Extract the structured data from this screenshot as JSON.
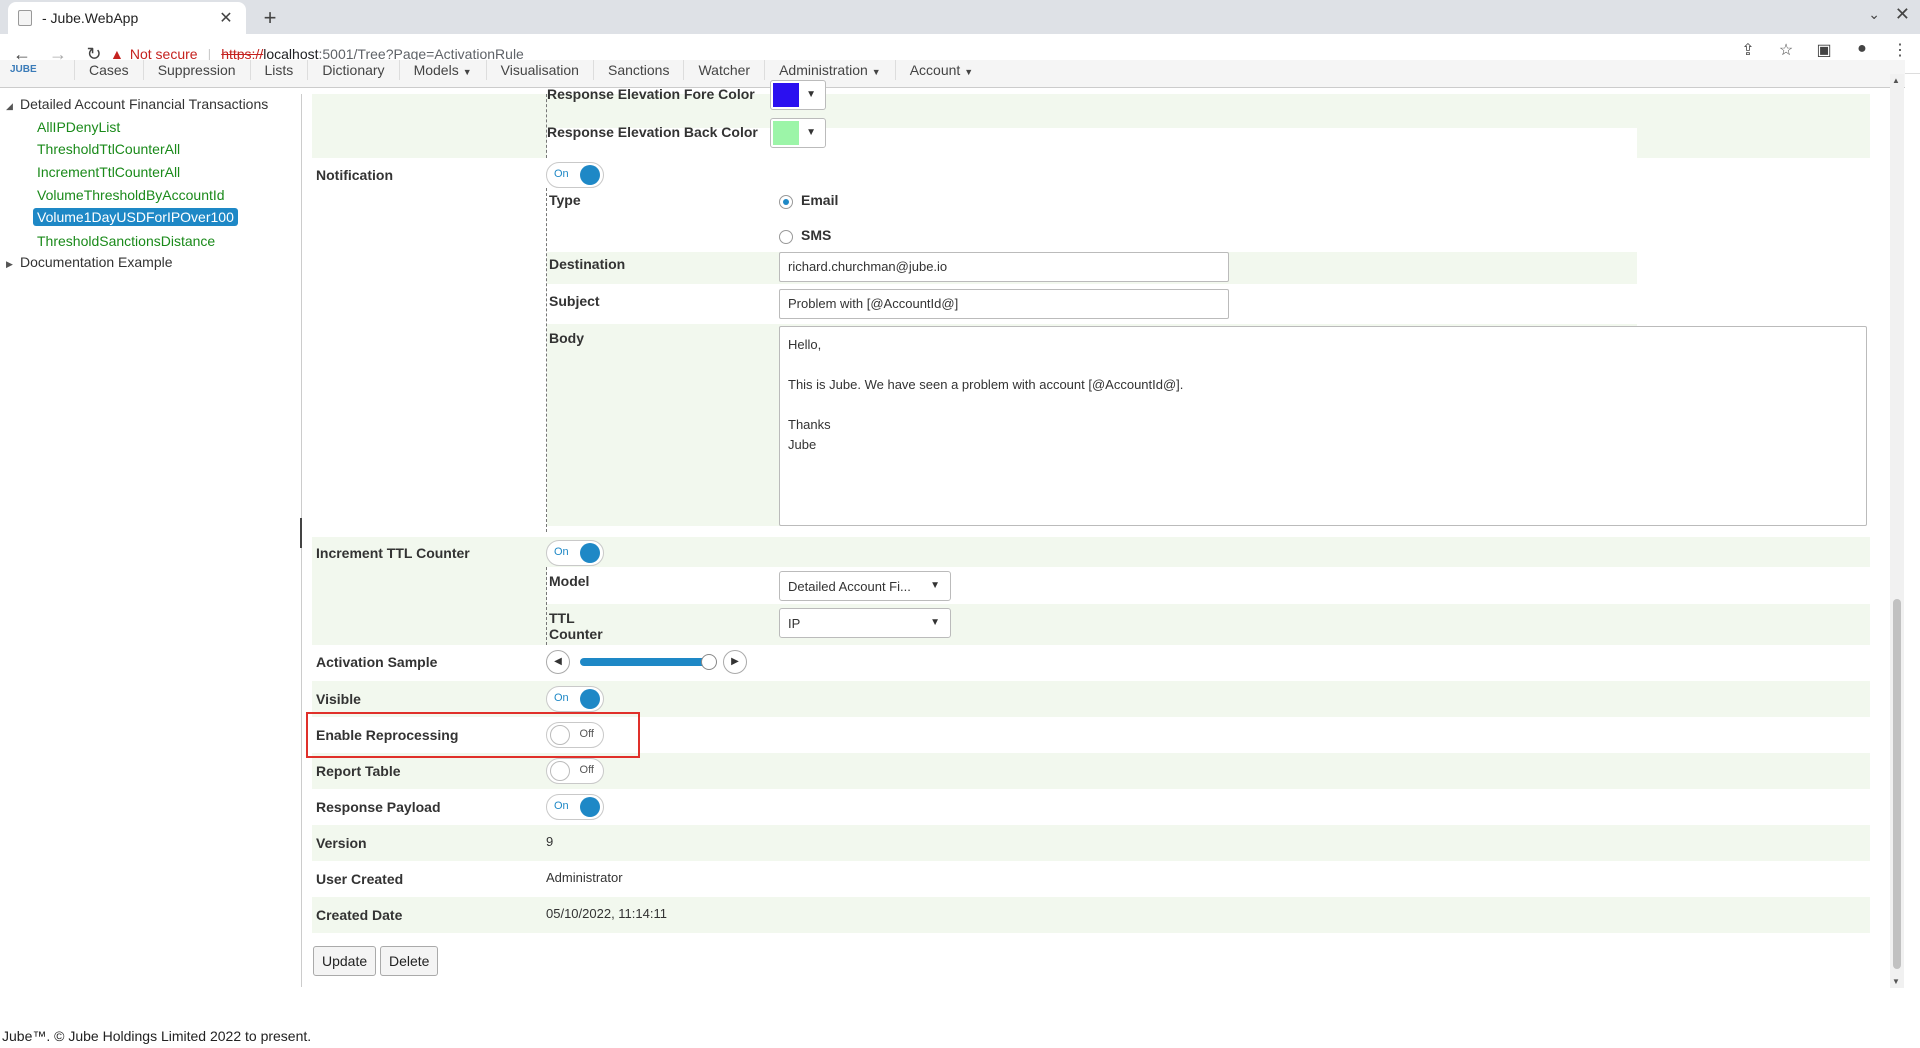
{
  "browser": {
    "tab_title": "- Jube.WebApp",
    "not_secure": "Not secure",
    "url_scheme": "https://",
    "url_host": "localhost",
    "url_path": ":5001/Tree?Page=ActivationRule"
  },
  "appnav": {
    "logo": "JUBE",
    "items": [
      "Cases",
      "Suppression",
      "Lists",
      "Dictionary",
      "Models",
      "Visualisation",
      "Sanctions",
      "Watcher",
      "Administration",
      "Account"
    ]
  },
  "tree": {
    "parent": "Detailed Account Financial Transactions",
    "children": [
      "AllIPDenyList",
      "ThresholdTtlCounterAll",
      "IncrementTtlCounterAll",
      "VolumeThresholdByAccountId",
      "Volume1DayUSDForIPOver100",
      "ThresholdSanctionsDistance"
    ],
    "selected_index": 4,
    "sibling": "Documentation Example"
  },
  "form": {
    "response_elevation_fore_color": {
      "label": "Response Elevation Fore Color",
      "color": "#2b10f0"
    },
    "response_elevation_back_color": {
      "label": "Response Elevation Back Color",
      "color": "#9cf5a8"
    },
    "notification": {
      "label": "Notification",
      "toggle": "On",
      "type_label": "Type",
      "type_options": [
        "Email",
        "SMS"
      ],
      "type_selected": "Email",
      "destination_label": "Destination",
      "destination_value": "richard.churchman@jube.io",
      "subject_label": "Subject",
      "subject_value": "Problem with [@AccountId@]",
      "body_label": "Body",
      "body_value": "Hello,\n\nThis is Jube.  We have seen a problem with account [@AccountId@].\n\nThanks\nJube"
    },
    "increment_ttl_counter": {
      "label": "Increment TTL Counter",
      "toggle": "On",
      "model_label": "Model",
      "model_value": "Detailed Account Fi...",
      "ttl_counter_label": "TTL Counter",
      "ttl_counter_value": "IP"
    },
    "activation_sample": {
      "label": "Activation Sample",
      "fraction": 0.95
    },
    "visible": {
      "label": "Visible",
      "toggle": "On"
    },
    "enable_reprocessing": {
      "label": "Enable Reprocessing",
      "toggle": "Off"
    },
    "report_table": {
      "label": "Report Table",
      "toggle": "Off"
    },
    "response_payload": {
      "label": "Response Payload",
      "toggle": "On"
    },
    "version": {
      "label": "Version",
      "value": "9"
    },
    "user_created": {
      "label": "User Created",
      "value": "Administrator"
    },
    "created_date": {
      "label": "Created Date",
      "value": "05/10/2022, 11:14:11"
    },
    "buttons": {
      "update": "Update",
      "delete": "Delete"
    }
  },
  "footer": "Jube™. © Jube Holdings Limited 2022 to present."
}
